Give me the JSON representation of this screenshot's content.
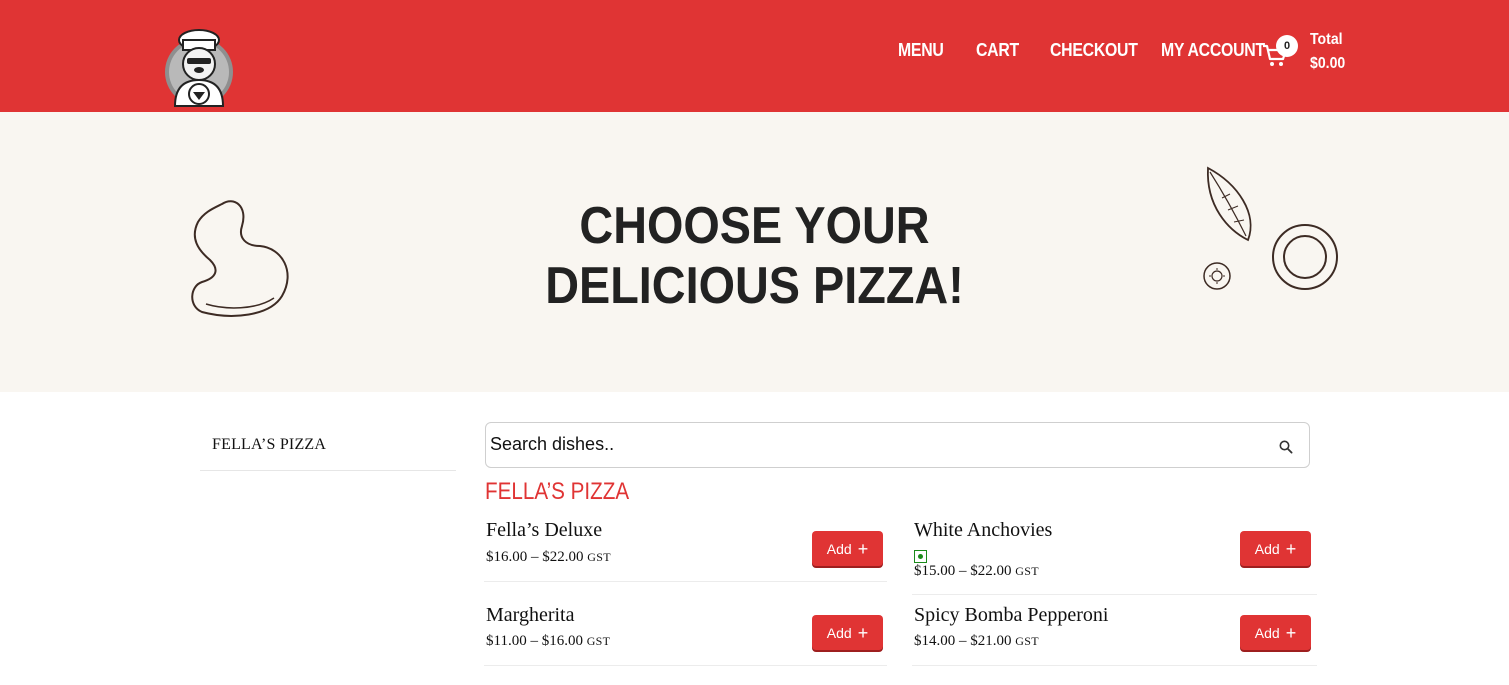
{
  "header": {
    "nav": [
      "MENU",
      "CART",
      "CHECKOUT",
      "MY ACCOUNT"
    ],
    "cart_count": "0",
    "total_label": "Total",
    "total_value": "$0.00",
    "background_color": "#e03434"
  },
  "hero": {
    "title_line1": "CHOOSE YOUR",
    "title_line2": "DELICIOUS PIZZA!"
  },
  "sidebar": {
    "items": [
      "FELLA’S PIZZA"
    ]
  },
  "search": {
    "placeholder": "Search dishes.."
  },
  "category": {
    "title": "FELLA’S PIZZA",
    "add_label": "Add",
    "dishes": [
      {
        "name": "Fella’s Deluxe",
        "price": "$16.00 – $22.00",
        "tax": "GST",
        "veg": false
      },
      {
        "name": "White Anchovies",
        "price": "$15.00 – $22.00",
        "tax": "GST",
        "veg": true
      },
      {
        "name": "Margherita",
        "price": "$11.00 – $16.00",
        "tax": "GST",
        "veg": false
      },
      {
        "name": "Spicy Bomba Pepperoni",
        "price": "$14.00 – $21.00",
        "tax": "GST",
        "veg": false
      }
    ]
  },
  "icons": [
    "chef-bear-logo-icon",
    "cart-icon",
    "search-icon",
    "dough-doodle-icon",
    "basil-olive-doodle-icon",
    "veg-indicator-icon"
  ]
}
